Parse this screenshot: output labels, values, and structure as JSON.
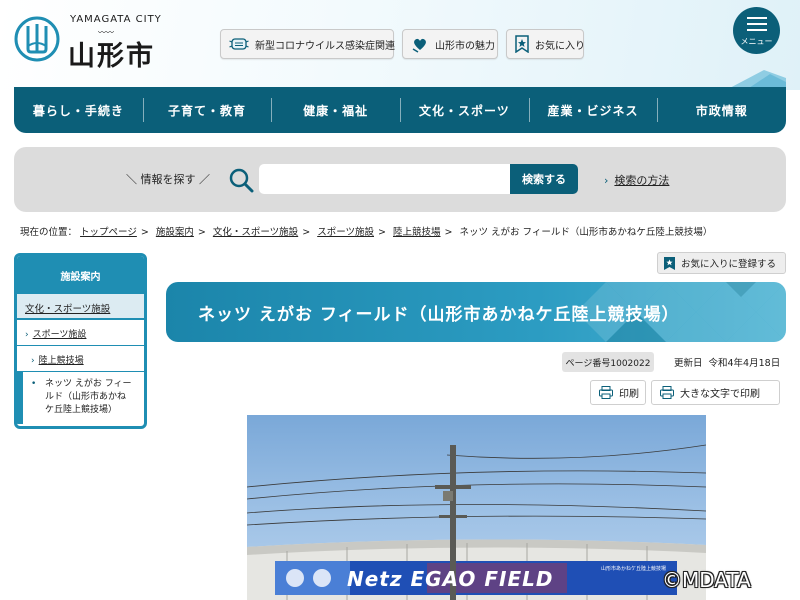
{
  "header": {
    "logo_en": "YAMAGATA CITY",
    "logo_ja": "山形市",
    "buttons": [
      {
        "label": "新型コロナウイルス感染症関連",
        "icon": "mask-icon"
      },
      {
        "label": "山形市の魅力",
        "icon": "heart-hand-icon"
      },
      {
        "label": "お気に入り",
        "icon": "bookmark-star-icon"
      }
    ],
    "menu_label": "メニュー"
  },
  "nav": {
    "items": [
      "暮らし・手続き",
      "子育て・教育",
      "健康・福祉",
      "文化・スポーツ",
      "産業・ビジネス",
      "市政情報"
    ]
  },
  "search": {
    "label": "＼ 情報を探す ／",
    "placeholder": "",
    "button": "検索する",
    "method_link": "検索の方法"
  },
  "breadcrumb": {
    "prefix": "現在の位置：",
    "links": [
      "トップページ",
      "施設案内",
      "文化・スポーツ施設",
      "スポーツ施設",
      "陸上競技場"
    ],
    "current": "ネッツ えがお フィールド（山形市あかねケ丘陸上競技場）"
  },
  "sidebar": {
    "heading": "施設案内",
    "category": "文化・スポーツ施設",
    "item1": "スポーツ施設",
    "item2": "陸上競技場",
    "current": "ネッツ えがお フィールド（山形市あかねケ丘陸上競技場）"
  },
  "page": {
    "fav_register": "お気に入りに登録する",
    "title": "ネッツ えがお フィールド（山形市あかねケ丘陸上競技場）",
    "page_id": "ページ番号1002022",
    "updated_label": "更新日",
    "updated_date": "令和4年4月18日",
    "print": "印刷",
    "print_large": "大きな文字で印刷"
  },
  "photo": {
    "banner_text": "Netz EGAO FIELD",
    "banner_small": "山形市あかねケ丘陸上競技場"
  },
  "copyright": "©MDATA",
  "colors": {
    "primary": "#0b5f79",
    "accent": "#1f8eb3",
    "search_bg": "#dcdcdc"
  }
}
